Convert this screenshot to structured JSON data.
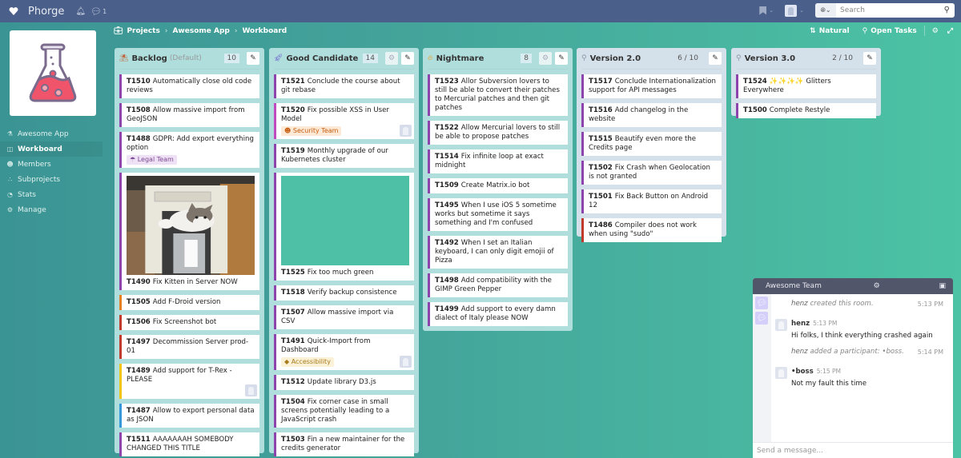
{
  "app": {
    "name": "Phorge",
    "chat_count": "1"
  },
  "search": {
    "placeholder": "Search"
  },
  "breadcrumb": [
    "Projects",
    "Awesome App",
    "Workboard"
  ],
  "toolbar": {
    "sort_label": "Natural",
    "filter_label": "Open Tasks"
  },
  "sidebar": {
    "items": [
      {
        "label": "Awesome App",
        "icon": "flask-icon",
        "active": false
      },
      {
        "label": "Workboard",
        "icon": "board-icon",
        "active": true
      },
      {
        "label": "Members",
        "icon": "users-icon",
        "active": false
      },
      {
        "label": "Subprojects",
        "icon": "sitemap-icon",
        "active": false
      },
      {
        "label": "Stats",
        "icon": "dashboard-icon",
        "active": false
      },
      {
        "label": "Manage",
        "icon": "gears-icon",
        "active": false
      }
    ]
  },
  "columns": [
    {
      "title": "Backlog",
      "subtitle": "(Default)",
      "count": "10",
      "icon": "backlog-icon",
      "cards": [
        {
          "id": "T1510",
          "title": "Automatically close old code reviews",
          "color": "purple"
        },
        {
          "id": "T1508",
          "title": "Allow massive import from GeoJSON",
          "color": "purple"
        },
        {
          "id": "T1488",
          "title": "GDPR: Add export everything option",
          "color": "purple",
          "tag": "Legal Team"
        },
        {
          "id": "T1490",
          "title": "Fix Kitten in Server NOW",
          "color": "purple",
          "cover": "kitten-in-computer-image"
        },
        {
          "id": "T1505",
          "title": "Add F-Droid version",
          "color": "orange"
        },
        {
          "id": "T1506",
          "title": "Fix Screenshot bot",
          "color": "red"
        },
        {
          "id": "T1497",
          "title": "Decommission Server prod-01",
          "color": "red"
        },
        {
          "id": "T1489",
          "title": "Add support for T-Rex - PLEASE",
          "color": "yellow",
          "avatar": true
        },
        {
          "id": "T1487",
          "title": "Allow to export personal data as JSON",
          "color": "blue"
        },
        {
          "id": "T1511",
          "title": "AAAAAAAH SOMEBODY CHANGED THIS TITLE",
          "color": "purple"
        }
      ]
    },
    {
      "title": "Good Candidate",
      "count": "14",
      "icon": "rocket-icon",
      "cards": [
        {
          "id": "T1521",
          "title": "Conclude the course about git rebase",
          "color": "purple"
        },
        {
          "id": "T1520",
          "title": "Fix possible XSS in User Model",
          "color": "magenta",
          "tag": "Security Team",
          "avatar": true
        },
        {
          "id": "T1519",
          "title": "Monthly upgrade of our Kubernetes cluster",
          "color": "purple"
        },
        {
          "id": "T1525",
          "title": "Fix too much green",
          "color": "purple",
          "cover": "green-image"
        },
        {
          "id": "T1518",
          "title": "Verify backup consistence",
          "color": "purple"
        },
        {
          "id": "T1507",
          "title": "Allow massive import via CSV",
          "color": "purple"
        },
        {
          "id": "T1491",
          "title": "Quick-Import from Dashboard",
          "color": "purple",
          "tag": "Accessibility",
          "avatar": true
        },
        {
          "id": "T1512",
          "title": "Update library D3.js",
          "color": "purple"
        },
        {
          "id": "T1504",
          "title": "Fix corner case in small screens potentially leading to a JavaScript crash",
          "color": "purple"
        },
        {
          "id": "T1503",
          "title": "Fin a new maintainer for the credits generator",
          "color": "purple"
        }
      ]
    },
    {
      "title": "Nightmare",
      "count": "8",
      "icon": "fire-icon",
      "cards": [
        {
          "id": "T1523",
          "title": "Allor Subversion lovers to still be able to convert their patches to Mercurial patches and then git patches",
          "color": "purple"
        },
        {
          "id": "T1522",
          "title": "Allow Mercurial lovers to still be able to propose patches",
          "color": "purple"
        },
        {
          "id": "T1514",
          "title": "Fix infinite loop at exact midnight",
          "color": "purple"
        },
        {
          "id": "T1509",
          "title": "Create Matrix.io bot",
          "color": "purple"
        },
        {
          "id": "T1495",
          "title": "When I use iOS 5 sometime works but sometime it says something and I'm confused",
          "color": "purple"
        },
        {
          "id": "T1492",
          "title": "When I set an Italian keyboard, I can only digit emojii of Pizza",
          "color": "purple"
        },
        {
          "id": "T1498",
          "title": "Add compatibility with the GIMP Green Pepper",
          "color": "purple"
        },
        {
          "id": "T1499",
          "title": "Add support to every damn dialect of Italy please NOW",
          "color": "purple"
        }
      ]
    },
    {
      "title": "Version 2.0",
      "count": "6 / 10",
      "icon": "map-marker-icon",
      "cards": [
        {
          "id": "T1517",
          "title": "Conclude Internationalization support for API messages",
          "color": "purple"
        },
        {
          "id": "T1516",
          "title": "Add changelog in the website",
          "color": "purple"
        },
        {
          "id": "T1515",
          "title": "Beautify even more the Credits page",
          "color": "purple"
        },
        {
          "id": "T1502",
          "title": "Fix Crash when Geolocation is not granted",
          "color": "purple"
        },
        {
          "id": "T1501",
          "title": "Fix Back Button on Android 12",
          "color": "purple"
        },
        {
          "id": "T1486",
          "title": "Compiler does not work when using \"sudo\"",
          "color": "red"
        }
      ]
    },
    {
      "title": "Version 3.0",
      "count": "2 / 10",
      "icon": "map-marker-icon",
      "cards": [
        {
          "id": "T1524",
          "title": "✨✨✨✨ Glitters Everywhere",
          "color": "purple"
        },
        {
          "id": "T1500",
          "title": "Complete Restyle",
          "color": "purple"
        }
      ]
    }
  ],
  "chat": {
    "room": "Awesome Team",
    "messages": [
      {
        "type": "system",
        "user": "henz",
        "text": "created this room.",
        "time": "5:13 PM"
      },
      {
        "type": "message",
        "user": "henz",
        "time": "5:13 PM",
        "text": "Hi folks, I think everything crashed again"
      },
      {
        "type": "system",
        "user": "henz",
        "text": "added a participant: •boss.",
        "time": "5:14 PM"
      },
      {
        "type": "message",
        "user": "•boss",
        "time": "5:15 PM",
        "text": "Not my fault this time"
      }
    ],
    "input_placeholder": "Send a message..."
  }
}
